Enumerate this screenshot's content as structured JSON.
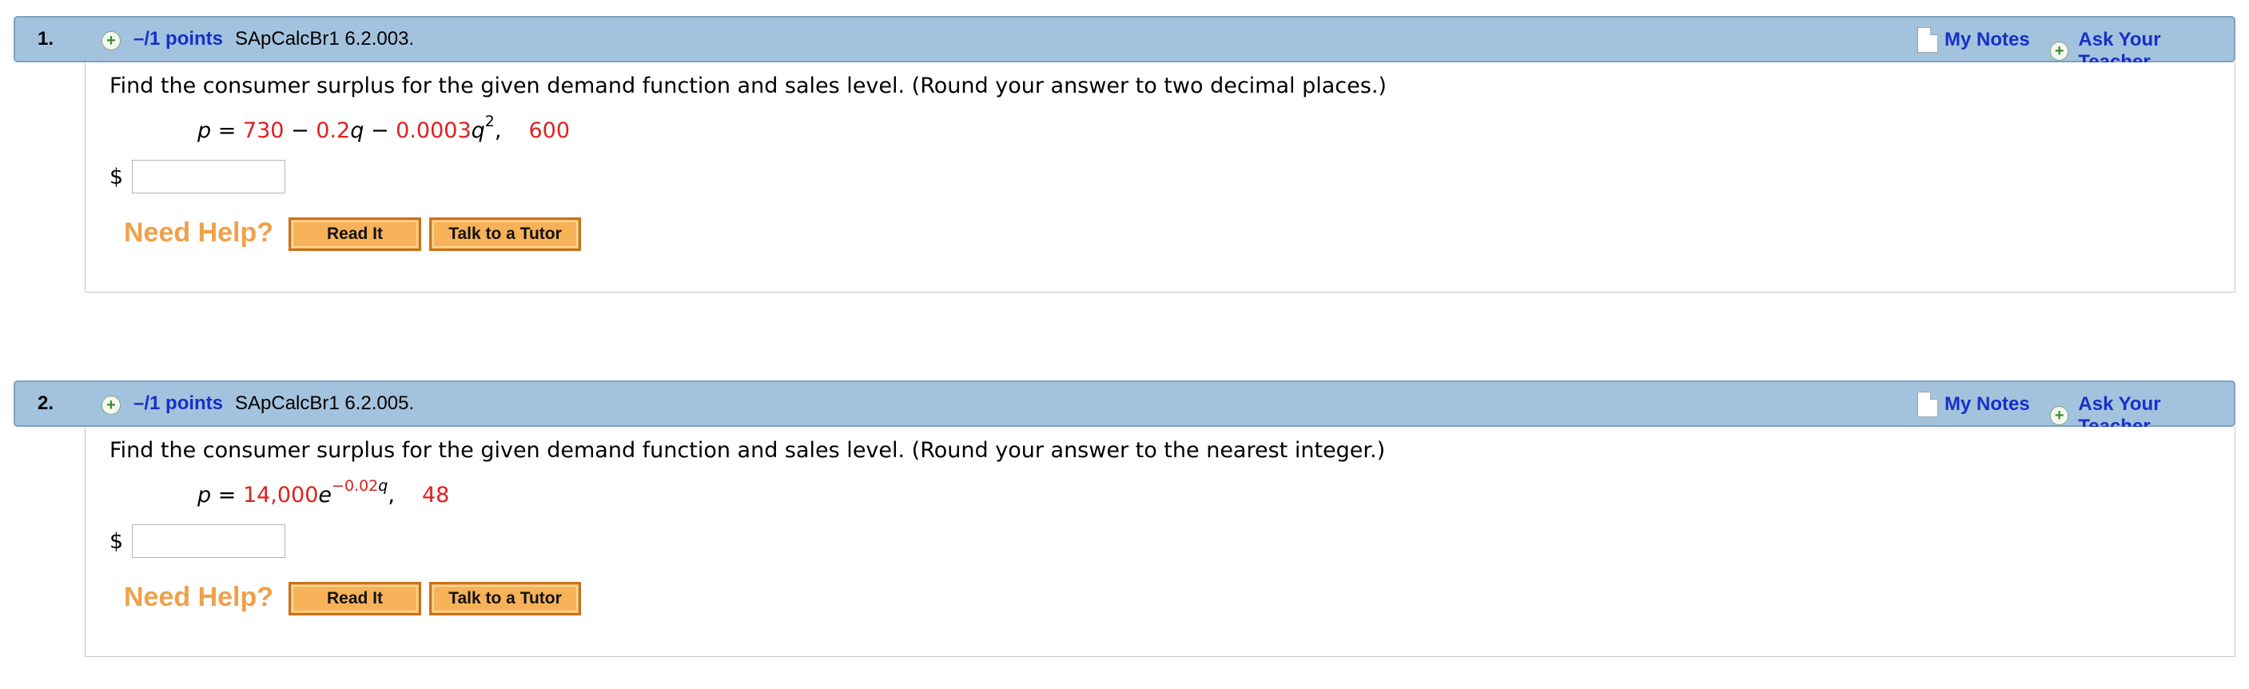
{
  "questions": [
    {
      "number": "1.",
      "points": "–/1 points",
      "id": "SApCalcBr1 6.2.003.",
      "my_notes": "My Notes",
      "ask_teacher": "Ask Your Teacher",
      "prompt": "Find the consumer surplus for the given demand function and sales level. (Round your answer to two decimal places.)",
      "formula": {
        "p": "p",
        "eq": " = ",
        "c1": "730",
        "op1": " − ",
        "c2": "0.2",
        "q1": "q",
        "op2": " − ",
        "c3": "0.0003",
        "q2": "q",
        "exp": "2",
        "comma": ",",
        "level": "600"
      },
      "dollar": "$",
      "answer_value": "",
      "need_help": "Need Help?",
      "read_it": "Read It",
      "talk_tutor": "Talk to a Tutor"
    },
    {
      "number": "2.",
      "points": "–/1 points",
      "id": "SApCalcBr1 6.2.005.",
      "my_notes": "My Notes",
      "ask_teacher": "Ask Your Teacher",
      "prompt": "Find the consumer surplus for the given demand function and sales level. (Round your answer to the nearest integer.)",
      "formula": {
        "p": "p",
        "eq": " = ",
        "c1": "14,000",
        "e": "e",
        "exp_coef": "−0.02",
        "exp_var": "q",
        "comma": ",",
        "level": "48"
      },
      "dollar": "$",
      "answer_value": "",
      "need_help": "Need Help?",
      "read_it": "Read It",
      "talk_tutor": "Talk to a Tutor"
    }
  ],
  "colors": {
    "header_bg": "#a3c2dd",
    "link": "#1530c8",
    "formula_value": "#e02020",
    "need_help": "#f0a04b",
    "help_button": "#f7b259"
  },
  "icons": {
    "expand": "plus-circle-icon",
    "notes": "document-icon"
  }
}
